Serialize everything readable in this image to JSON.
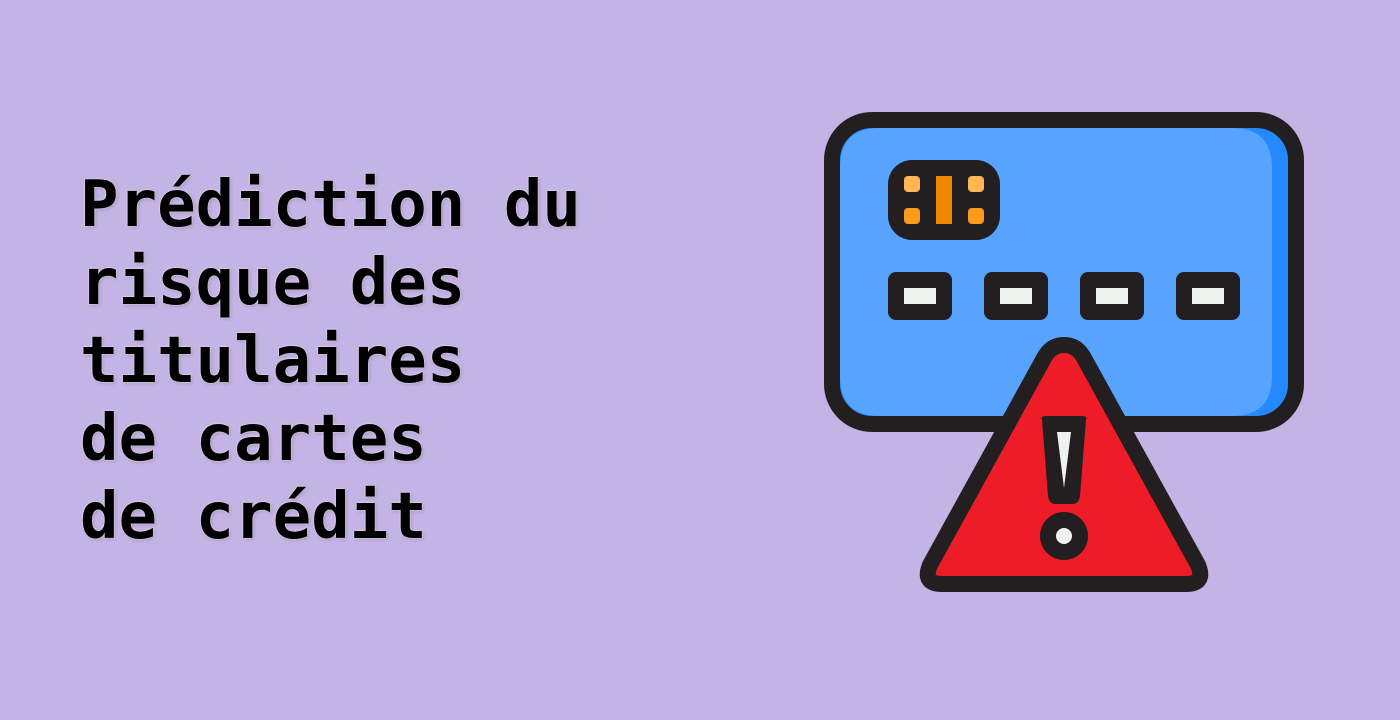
{
  "title": {
    "lines": [
      "Prédiction du",
      "risque des",
      "titulaires",
      "de cartes",
      "de crédit"
    ]
  },
  "illustration": {
    "icon": "credit-card-warning-icon",
    "colors": {
      "background": "#c4b3e5",
      "outline": "#231f20",
      "card": "#57a3fe",
      "card_edge": "#2488ff",
      "chip_light": "#ffb655",
      "chip": "#fc9b1a",
      "chip_dark": "#ee8700",
      "warning": "#ed1c27",
      "white": "#eff1ef"
    }
  }
}
